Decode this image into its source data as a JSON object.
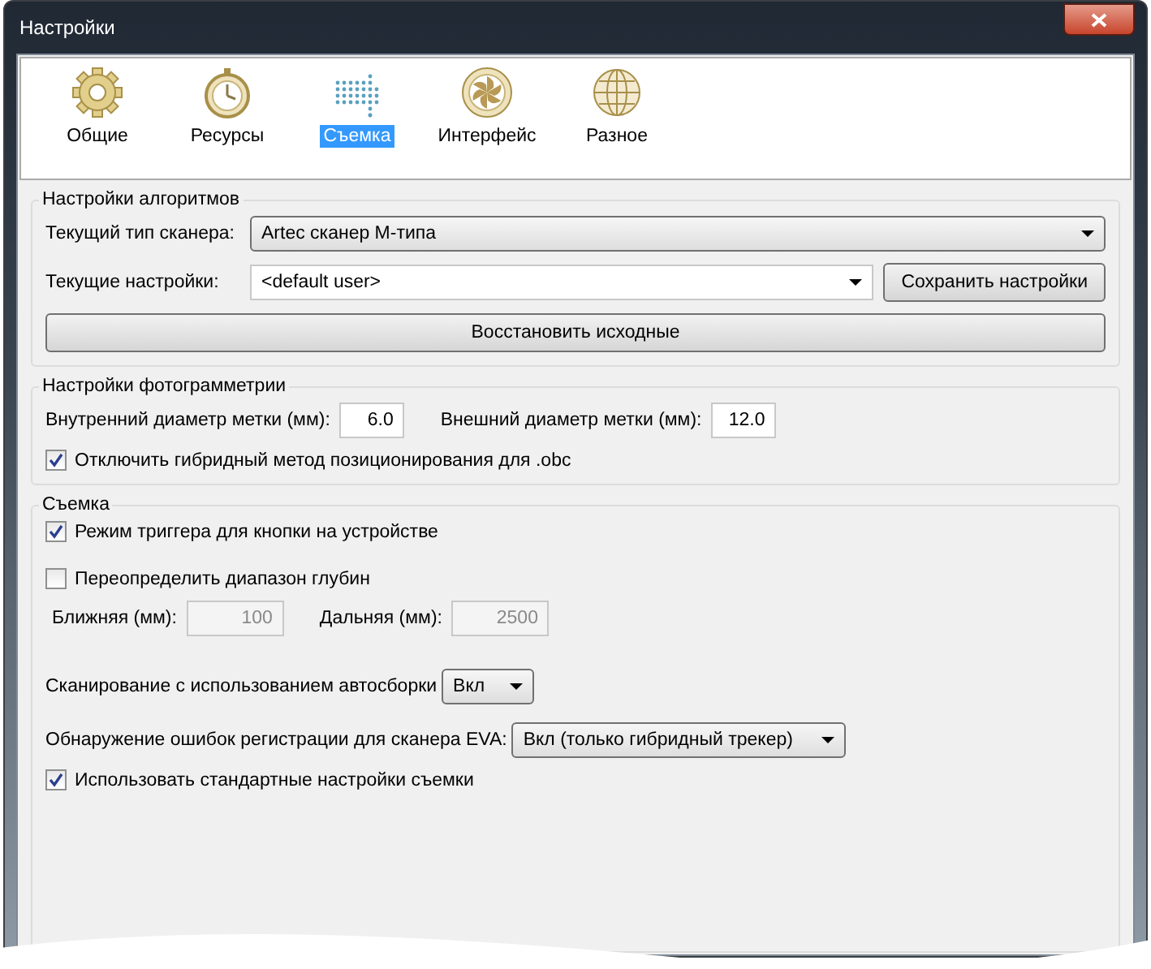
{
  "window": {
    "title": "Настройки"
  },
  "tabs": [
    {
      "label": "Общие",
      "selected": false,
      "kind": "gear"
    },
    {
      "label": "Ресурсы",
      "selected": false,
      "kind": "stopwatch"
    },
    {
      "label": "Съемка",
      "selected": true,
      "kind": "dots"
    },
    {
      "label": "Интерфейс",
      "selected": false,
      "kind": "aperture"
    },
    {
      "label": "Разное",
      "selected": false,
      "kind": "globe"
    }
  ],
  "algorithm_settings": {
    "title": "Настройки алгоритмов",
    "scanner_type": {
      "label": "Текущий тип сканера:",
      "value": "Artec сканер М-типа"
    },
    "current_settings": {
      "label": "Текущие настройки:",
      "value": "<default user>"
    },
    "save_button": "Сохранить настройки",
    "restore_button": "Восстановить исходные"
  },
  "photogrammetry": {
    "title": "Настройки фотограмметрии",
    "inner_diameter": {
      "label": "Внутренний диаметр метки (мм):",
      "value": "6.0"
    },
    "outer_diameter": {
      "label": "Внешний диаметр метки (мм):",
      "value": "12.0"
    },
    "disable_hybrid": {
      "label": "Отключить гибридный метод позиционирования для .obc",
      "checked": true
    }
  },
  "capture": {
    "title": "Съемка",
    "trigger_mode": {
      "label": "Режим триггера для кнопки на устройстве",
      "checked": true
    },
    "override_depth": {
      "label": "Переопределить диапазон глубин",
      "checked": false
    },
    "near": {
      "label": "Ближняя (мм):",
      "value": "100",
      "disabled": true
    },
    "far": {
      "label": "Дальняя (мм):",
      "value": "2500",
      "disabled": true
    },
    "autoassembly": {
      "label": "Сканирование с использованием автосборки",
      "value": "Вкл"
    },
    "error_detection": {
      "label": "Обнаружение ошибок регистрации для сканера EVA:",
      "value": "Вкл (только гибридный трекер)"
    },
    "use_default": {
      "label": "Использовать стандартные настройки съемки",
      "checked": true
    }
  }
}
